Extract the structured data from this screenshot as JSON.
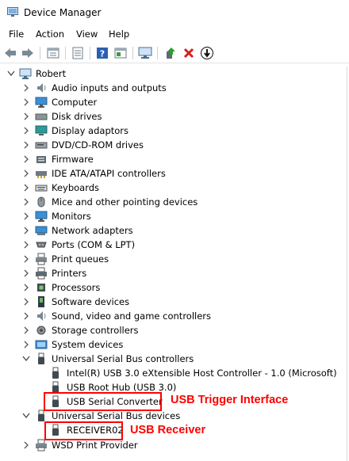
{
  "window": {
    "title": "Device Manager"
  },
  "menu": {
    "file": "File",
    "action": "Action",
    "view": "View",
    "help": "Help"
  },
  "toolbar": {
    "back": "back-arrow-icon",
    "forward": "forward-arrow-icon",
    "properties": "properties-icon",
    "list": "list-view-icon",
    "help": "help-icon",
    "show": "show-hidden-icon",
    "scan": "scan-hardware-icon",
    "update": "update-driver-icon",
    "uninstall": "uninstall-icon",
    "disable": "disable-device-icon"
  },
  "tree": {
    "root": "Robert",
    "categories": [
      "Audio inputs and outputs",
      "Computer",
      "Disk drives",
      "Display adaptors",
      "DVD/CD-ROM drives",
      "Firmware",
      "IDE ATA/ATAPI controllers",
      "Keyboards",
      "Mice and other pointing devices",
      "Monitors",
      "Network adapters",
      "Ports (COM & LPT)",
      "Print queues",
      "Printers",
      "Processors",
      "Software devices",
      "Sound, video and game controllers",
      "Storage controllers",
      "System devices"
    ],
    "usb_controllers": {
      "label": "Universal Serial Bus controllers",
      "children": [
        "Intel(R) USB 3.0 eXtensible Host Controller - 1.0 (Microsoft)",
        "USB Root Hub (USB 3.0)",
        "USB Serial Converter"
      ]
    },
    "usb_devices": {
      "label": "Universal Serial Bus devices",
      "children": [
        "RECEIVER02"
      ]
    },
    "last": "WSD Print Provider"
  },
  "annotations": {
    "trigger": "USB Trigger Interface",
    "receiver": "USB Receiver"
  },
  "colors": {
    "annotation": "#ff0000",
    "accent": "#1e6fd9"
  }
}
